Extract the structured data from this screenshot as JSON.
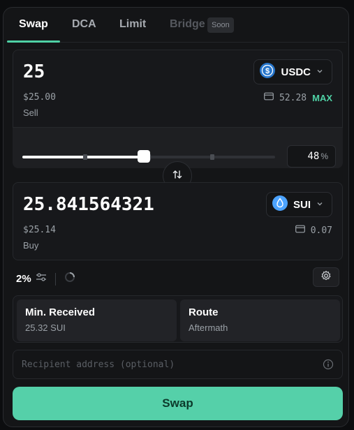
{
  "tabs": [
    {
      "label": "Swap",
      "active": true
    },
    {
      "label": "DCA",
      "active": false
    },
    {
      "label": "Limit",
      "active": false
    },
    {
      "label": "Bridge",
      "active": false,
      "badge": "Soon"
    }
  ],
  "sell": {
    "amount": "25",
    "usd": "$25.00",
    "label": "Sell",
    "token": {
      "symbol": "USDC",
      "icon": "usdc-icon",
      "color": "#2775ca"
    },
    "balance": "52.28",
    "max_label": "MAX"
  },
  "slider": {
    "percent": "48",
    "percent_sign": "%",
    "level": 0.48
  },
  "buy": {
    "amount": "25.841564321",
    "usd": "$25.14",
    "label": "Buy",
    "token": {
      "symbol": "SUI",
      "icon": "sui-icon",
      "color": "#4ca3ff"
    },
    "balance": "0.07"
  },
  "slippage": {
    "value": "2%"
  },
  "info": {
    "min_received": {
      "title": "Min. Received",
      "value": "25.32 SUI"
    },
    "route": {
      "title": "Route",
      "value": "Aftermath"
    }
  },
  "recipient": {
    "placeholder": "Recipient address (optional)"
  },
  "action": {
    "label": "Swap"
  },
  "colors": {
    "accent": "#4fd1a5",
    "button": "#55d0a9",
    "panel": "#141517"
  }
}
